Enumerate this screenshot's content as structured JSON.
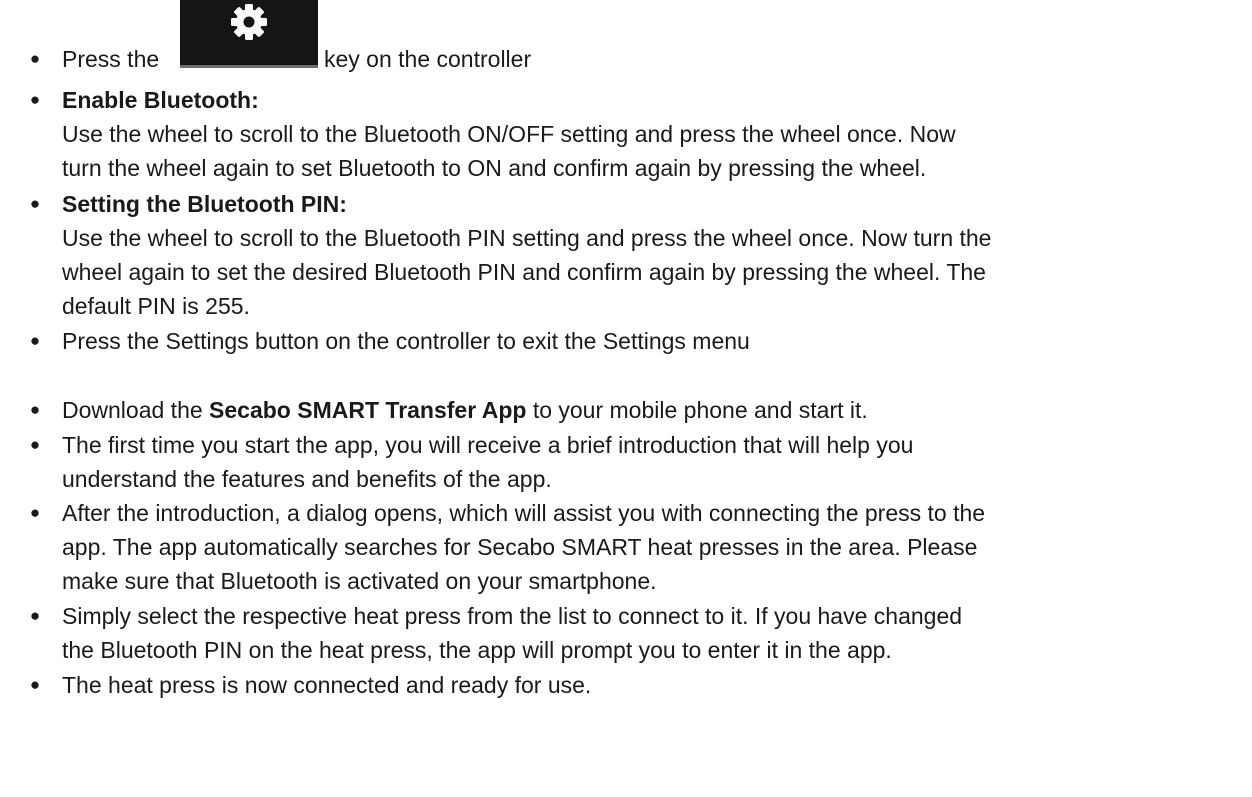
{
  "bullet_glyph": "●",
  "item1": {
    "before": "Press the",
    "icon": "gear-icon",
    "after": "key on the controller"
  },
  "item2": {
    "heading": "Enable Bluetooth:",
    "line1": "Use the wheel to scroll to the Bluetooth ON/OFF setting and press the wheel once. Now",
    "line2": "turn the wheel again to set Bluetooth to ON and confirm again by pressing the wheel."
  },
  "item3": {
    "heading": "Setting the Bluetooth PIN:",
    "line1": "Use the wheel to scroll to the Bluetooth PIN setting and press the wheel once. Now turn the",
    "line2": "wheel again to set the desired Bluetooth PIN and confirm again by pressing the wheel. The",
    "line3": "default PIN is 255."
  },
  "item4": {
    "text": "Press the Settings button on the controller to exit the Settings menu"
  },
  "item5": {
    "before": "Download the",
    "bold": "Secabo SMART Transfer App",
    "after": "to your mobile phone and start it."
  },
  "item6": {
    "line1": "The first time you start the app, you will receive a brief introduction that will help you",
    "line2": "understand the features and benefits of the app."
  },
  "item7": {
    "line1": "After the introduction, a dialog opens, which will assist you with connecting the press to the",
    "line2": "app. The app automatically searches for Secabo SMART heat presses in the area. Please",
    "line3": "make sure that Bluetooth is activated on your smartphone."
  },
  "item8": {
    "line1": "Simply select the respective heat press from the list to connect to it. If you have changed",
    "line2": "the Bluetooth PIN on the heat press, the app will prompt you to enter it in the app."
  },
  "item9": {
    "text": "The heat press is now connected and ready for use."
  }
}
